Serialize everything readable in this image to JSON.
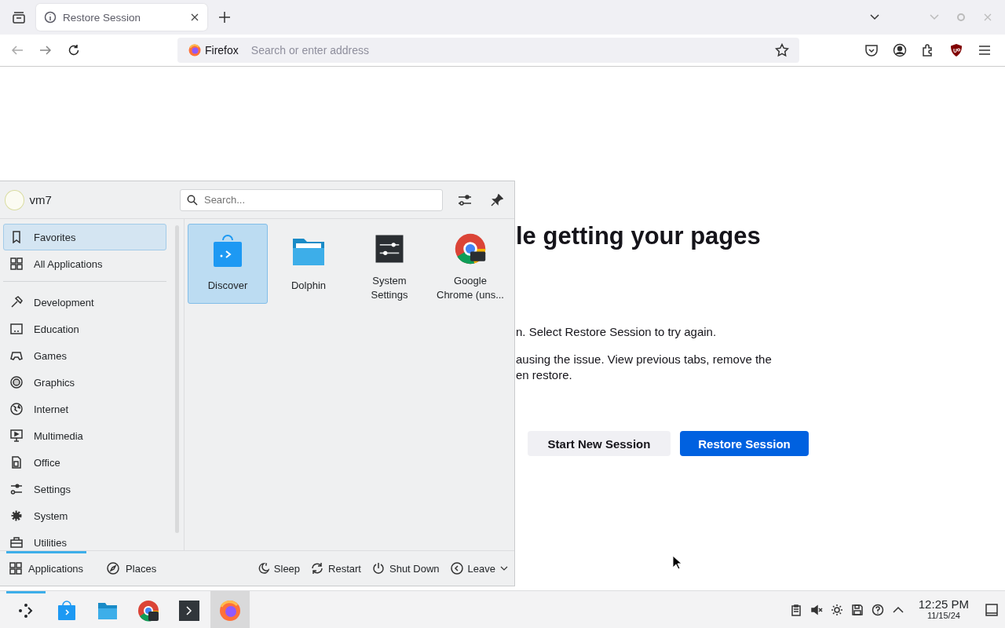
{
  "browser": {
    "tabs": [
      {
        "title": "Restore Session",
        "selected": true
      }
    ],
    "url_bar": {
      "identity": "Firefox",
      "placeholder": "Search or enter address"
    }
  },
  "page": {
    "heading": "le getting your pages",
    "paragraphs": [
      [
        "n. Select Restore Session to try again."
      ],
      [
        "ausing the issue. View previous tabs, remove the",
        "en restore."
      ]
    ],
    "buttons": [
      {
        "label": "Start New Session",
        "kind": "secondary"
      },
      {
        "label": "Restore Session",
        "kind": "primary"
      }
    ]
  },
  "launcher": {
    "user": "vm7",
    "search": {
      "placeholder": "Search..."
    },
    "views": [
      {
        "label": "Favorites",
        "selected": true
      },
      {
        "label": "All Applications",
        "selected": false
      }
    ],
    "categories": [
      {
        "label": "Development",
        "selected": false
      },
      {
        "label": "Education",
        "selected": false
      },
      {
        "label": "Games",
        "selected": false
      },
      {
        "label": "Graphics",
        "selected": false
      },
      {
        "label": "Internet",
        "selected": false
      },
      {
        "label": "Multimedia",
        "selected": false
      },
      {
        "label": "Office",
        "selected": false
      },
      {
        "label": "Settings",
        "selected": false
      },
      {
        "label": "System",
        "selected": false
      },
      {
        "label": "Utilities",
        "selected": false
      }
    ],
    "favorites": [
      {
        "label": "Discover",
        "selected": true
      },
      {
        "label": "Dolphin",
        "selected": false
      },
      {
        "label": "System Settings",
        "selected": false
      },
      {
        "label": "Google Chrome (uns...",
        "selected": false
      }
    ],
    "footer_tabs": [
      {
        "label": "Applications",
        "selected": true
      },
      {
        "label": "Places",
        "selected": false
      }
    ],
    "actions": [
      "Sleep",
      "Restart",
      "Shut Down",
      "Leave"
    ]
  },
  "taskbar": {
    "launcher_open": true,
    "items": [
      {
        "selected": false
      },
      {
        "selected": false
      },
      {
        "selected": false
      },
      {
        "selected": false
      },
      {
        "selected": true
      }
    ],
    "clock": {
      "time": "12:25 PM",
      "date": "11/15/24"
    }
  }
}
